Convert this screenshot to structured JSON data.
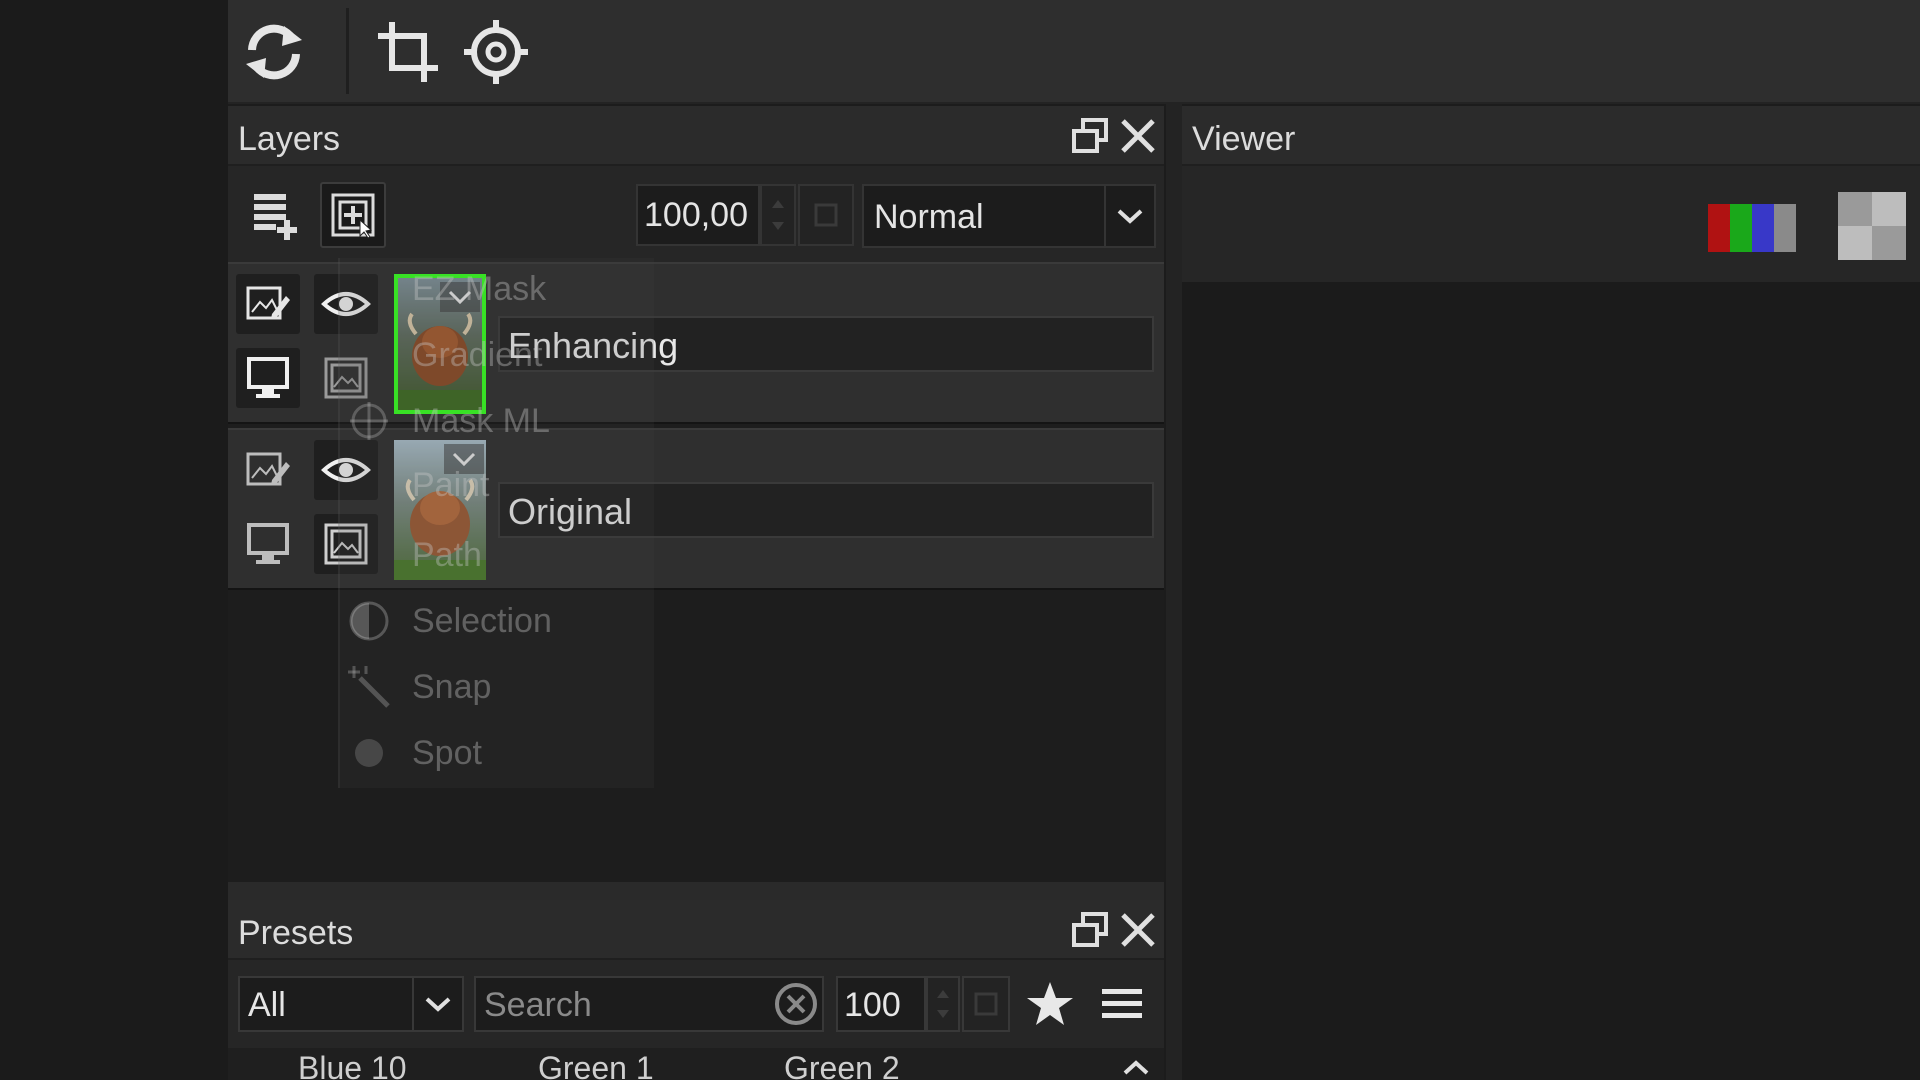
{
  "layers_panel": {
    "title": "Layers",
    "opacity_value": "100,00",
    "blend_mode": "Normal",
    "layers": [
      {
        "name": "Enhancing",
        "selected": true
      },
      {
        "name": "Original",
        "selected": false
      }
    ]
  },
  "mask_menu": {
    "items": [
      "EZ Mask",
      "Gradient",
      "Mask ML",
      "Paint",
      "Path",
      "Selection",
      "Snap",
      "Spot"
    ]
  },
  "viewer_panel": {
    "title": "Viewer"
  },
  "presets_panel": {
    "title": "Presets",
    "filter_value": "All",
    "search_placeholder": "Search",
    "amount_value": "100",
    "preset_items": [
      "Blue 10",
      "Green 1",
      "Green 2"
    ]
  },
  "colors": {
    "selection_border": "#36ff20",
    "panel_header": "#2b2b2b",
    "layer_row": "#2f2f2f"
  }
}
